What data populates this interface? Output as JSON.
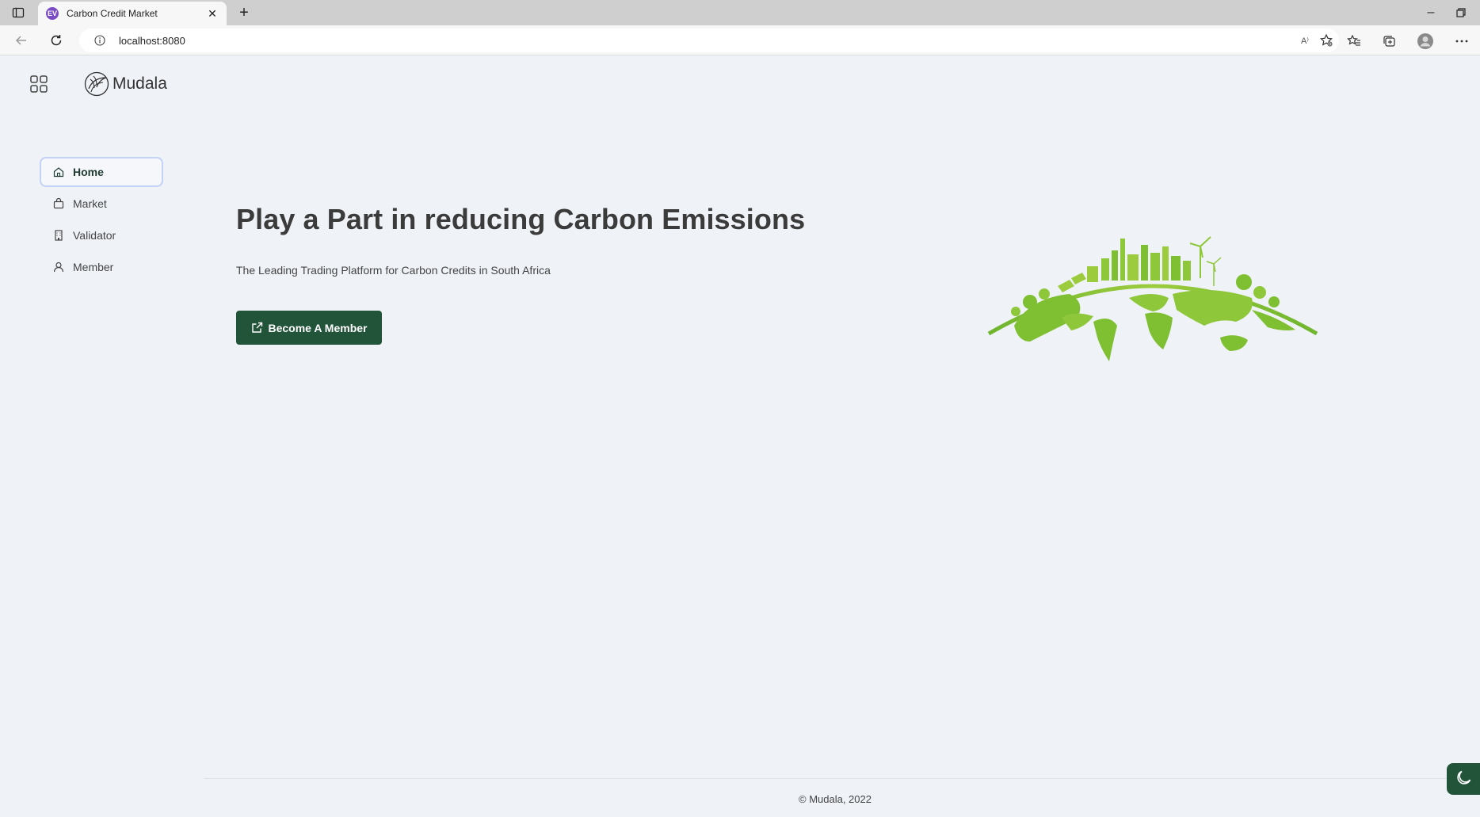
{
  "browser": {
    "tab_title": "Carbon Credit Market",
    "tab_favicon_text": "EV",
    "url": "localhost:8080",
    "read_aloud_label": "A⁾"
  },
  "app": {
    "brand_name": "Mudala",
    "brand_color": "#22543a"
  },
  "sidebar": {
    "items": [
      {
        "label": "Home",
        "icon": "home-icon",
        "active": true
      },
      {
        "label": "Market",
        "icon": "shopping-bag-icon",
        "active": false
      },
      {
        "label": "Validator",
        "icon": "building-icon",
        "active": false
      },
      {
        "label": "Member",
        "icon": "user-icon",
        "active": false
      }
    ]
  },
  "hero": {
    "title": "Play a Part in reducing Carbon Emissions",
    "subtitle": "The Leading Trading Platform for Carbon Credits in South Africa",
    "cta_label": "Become A Member",
    "illustration_color": "#8cc63f"
  },
  "footer": {
    "copyright": "© Mudala, 2022"
  }
}
